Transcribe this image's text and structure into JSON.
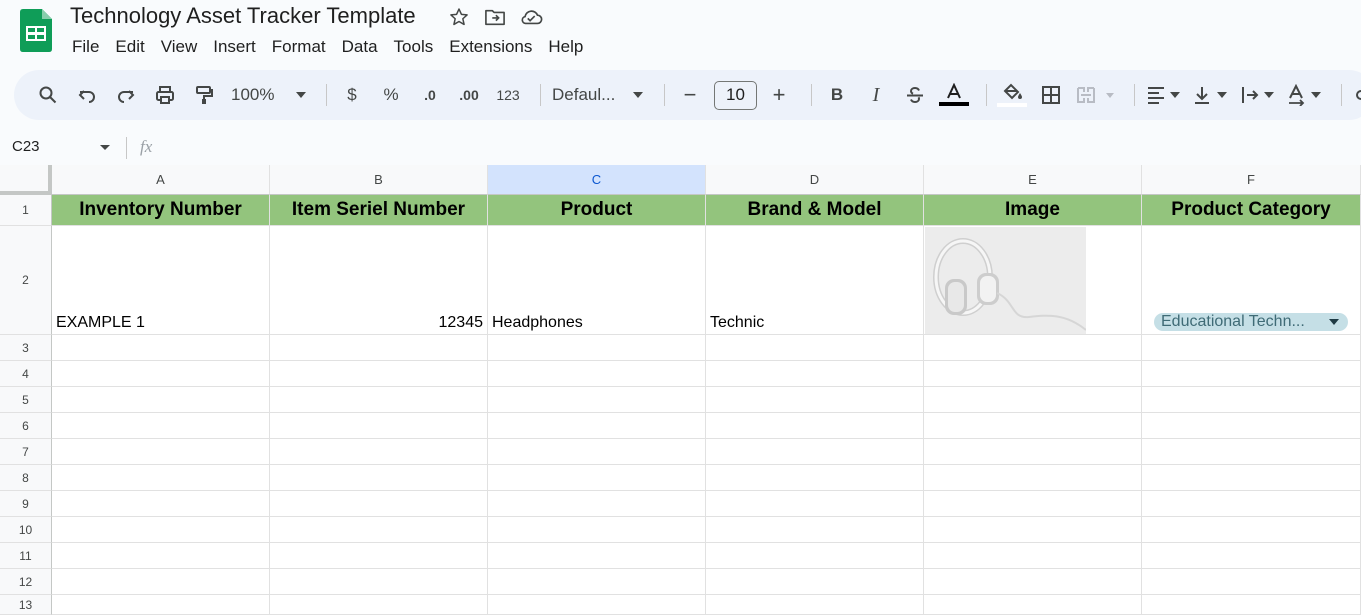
{
  "app": {
    "title": "Technology Asset Tracker Template",
    "brand_color": "#0f9d58"
  },
  "menu": [
    "File",
    "Edit",
    "View",
    "Insert",
    "Format",
    "Data",
    "Tools",
    "Extensions",
    "Help"
  ],
  "toolbar": {
    "zoom": "100%",
    "currency": "$",
    "percent": "%",
    "decrease_decimal": ".0",
    "increase_decimal": ".00",
    "number_format": "123",
    "font": "Defaul...",
    "font_size": "10",
    "minus": "−",
    "plus": "+",
    "bold": "B",
    "italic": "I"
  },
  "formula_bar": {
    "name_box": "C23",
    "fx": "fx"
  },
  "sheet": {
    "columns": [
      "A",
      "B",
      "C",
      "D",
      "E",
      "F"
    ],
    "selected_column": "C",
    "rows": [
      "1",
      "2",
      "3",
      "4",
      "5",
      "6",
      "7",
      "8",
      "9",
      "10",
      "11",
      "12",
      "13"
    ],
    "headers": [
      "Inventory Number",
      "Item Seriel Number",
      "Product",
      "Brand & Model",
      "Image",
      "Product Category"
    ],
    "header_color": "#93c47d",
    "row2": {
      "inventory": "EXAMPLE 1",
      "serial": "12345",
      "product": "Headphones",
      "brand": "Technic",
      "category": "Educational Techn..."
    }
  }
}
